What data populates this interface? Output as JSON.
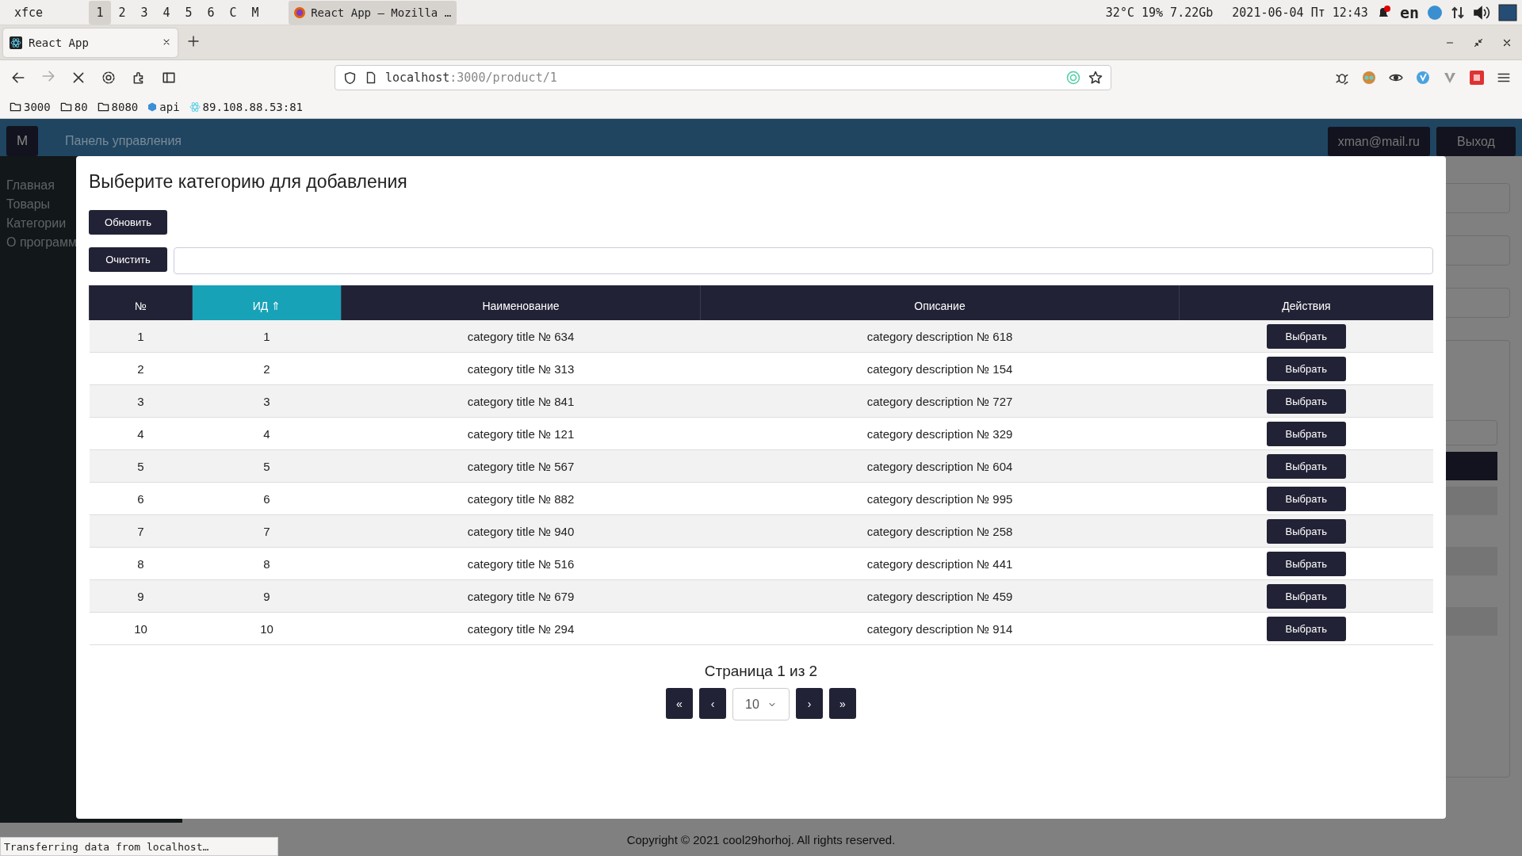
{
  "desktop_panel": {
    "menu_label": "xfce",
    "workspaces": [
      {
        "label": "1",
        "selected": true
      },
      {
        "label": "2",
        "selected": false
      },
      {
        "label": "3",
        "selected": false
      },
      {
        "label": "4",
        "selected": false
      },
      {
        "label": "5",
        "selected": false
      },
      {
        "label": "6",
        "selected": false
      },
      {
        "label": "C",
        "selected": false
      },
      {
        "label": "M",
        "selected": false
      }
    ],
    "task": "React App — Mozilla …",
    "sensors": "32°C 19% 7.22Gb",
    "clock": "2021-06-04 Пт 12:43",
    "keyboard": "en"
  },
  "browser": {
    "tab_title": "React App",
    "url_host": "localhost",
    "url_path": ":3000/product/1",
    "bookmarks": [
      {
        "label": "3000",
        "kind": "folder"
      },
      {
        "label": "80",
        "kind": "folder"
      },
      {
        "label": "8080",
        "kind": "folder"
      },
      {
        "label": "api",
        "kind": "cube"
      },
      {
        "label": "89.108.88.53:81",
        "kind": "atom"
      }
    ],
    "status_text": "Transferring data from localhost…"
  },
  "app": {
    "logo": "M",
    "title": "Панель управления",
    "user": "xman@mail.ru",
    "logout": "Выход",
    "nav": [
      "Главная",
      "Товары",
      "Категории",
      "О программ"
    ],
    "footer": "Copyright © 2021 cool29horhoj. All rights reserved."
  },
  "modal": {
    "title": "Выберите категорию для добавления",
    "refresh_button": "Обновить",
    "clear_button": "Очистить",
    "table": {
      "columns": [
        {
          "label": "№",
          "selected": false
        },
        {
          "label": "ИД ⇑",
          "selected": true
        },
        {
          "label": "Наименование",
          "selected": false
        },
        {
          "label": "Описание",
          "selected": false
        },
        {
          "label": "Действия",
          "selected": false
        }
      ],
      "rows": [
        {
          "cells": [
            "1",
            "1",
            "category title № 634",
            "category description № 618"
          ],
          "action": "Выбрать"
        },
        {
          "cells": [
            "2",
            "2",
            "category title № 313",
            "category description № 154"
          ],
          "action": "Выбрать"
        },
        {
          "cells": [
            "3",
            "3",
            "category title № 841",
            "category description № 727"
          ],
          "action": "Выбрать"
        },
        {
          "cells": [
            "4",
            "4",
            "category title № 121",
            "category description № 329"
          ],
          "action": "Выбрать"
        },
        {
          "cells": [
            "5",
            "5",
            "category title № 567",
            "category description № 604"
          ],
          "action": "Выбрать"
        },
        {
          "cells": [
            "6",
            "6",
            "category title № 882",
            "category description № 995"
          ],
          "action": "Выбрать"
        },
        {
          "cells": [
            "7",
            "7",
            "category title № 940",
            "category description № 258"
          ],
          "action": "Выбрать"
        },
        {
          "cells": [
            "8",
            "8",
            "category title № 516",
            "category description № 441"
          ],
          "action": "Выбрать"
        },
        {
          "cells": [
            "9",
            "9",
            "category title № 679",
            "category description № 459"
          ],
          "action": "Выбрать"
        },
        {
          "cells": [
            "10",
            "10",
            "category title № 294",
            "category description № 914"
          ],
          "action": "Выбрать"
        }
      ]
    },
    "page_label": "Страница 1 из 2",
    "pager": {
      "first": "«",
      "prev": "‹",
      "page_size": "10",
      "next": "›",
      "last": "»"
    }
  }
}
